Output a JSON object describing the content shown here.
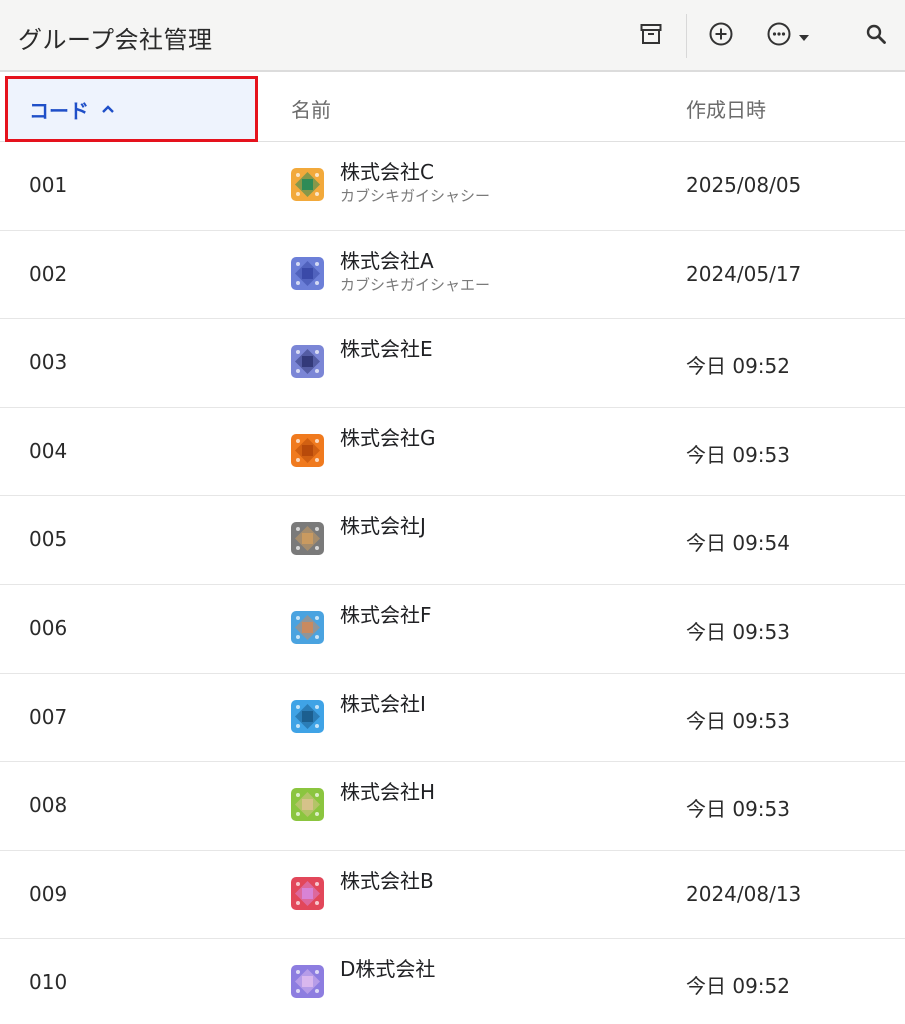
{
  "header": {
    "title": "グループ会社管理",
    "icons": [
      "archive-icon",
      "add-circle-icon",
      "more-circle-icon",
      "dropdown-caret-icon",
      "search-icon"
    ]
  },
  "columns": {
    "code": "コード",
    "name": "名前",
    "created": "作成日時",
    "sort_icon": "chevron-up-icon"
  },
  "colors": {
    "accent": "#1f4fc8",
    "highlight_border": "#e5121d",
    "selected_header_bg": "#eef3fd"
  },
  "rows": [
    {
      "code": "001",
      "name": "株式会社C",
      "kana": "カブシキガイシャシー",
      "date": "2025/08/05",
      "avatar_color": "#f2a93b",
      "accent": "#2e8b57"
    },
    {
      "code": "002",
      "name": "株式会社A",
      "kana": "カブシキガイシャエー",
      "date": "2024/05/17",
      "avatar_color": "#6c7fd8",
      "accent": "#3a4aa8"
    },
    {
      "code": "003",
      "name": "株式会社E",
      "kana": "",
      "date": "今日 09:52",
      "avatar_color": "#7b86d6",
      "accent": "#333a7a"
    },
    {
      "code": "004",
      "name": "株式会社G",
      "kana": "",
      "date": "今日 09:53",
      "avatar_color": "#f07a1e",
      "accent": "#b84a0a"
    },
    {
      "code": "005",
      "name": "株式会社J",
      "kana": "",
      "date": "今日 09:54",
      "avatar_color": "#7a7a7a",
      "accent": "#c99a60"
    },
    {
      "code": "006",
      "name": "株式会社F",
      "kana": "",
      "date": "今日 09:53",
      "avatar_color": "#4aa3e0",
      "accent": "#c98a60"
    },
    {
      "code": "007",
      "name": "株式会社I",
      "kana": "",
      "date": "今日 09:53",
      "avatar_color": "#3fa3e6",
      "accent": "#1c5f8f"
    },
    {
      "code": "008",
      "name": "株式会社H",
      "kana": "",
      "date": "今日 09:53",
      "avatar_color": "#8bc53f",
      "accent": "#d6c28a"
    },
    {
      "code": "009",
      "name": "株式会社B",
      "kana": "",
      "date": "2024/08/13",
      "avatar_color": "#e2475a",
      "accent": "#d883d6"
    },
    {
      "code": "010",
      "name": "D株式会社",
      "kana": "",
      "date": "今日 09:52",
      "avatar_color": "#8d7de0",
      "accent": "#d9b7ee"
    }
  ]
}
